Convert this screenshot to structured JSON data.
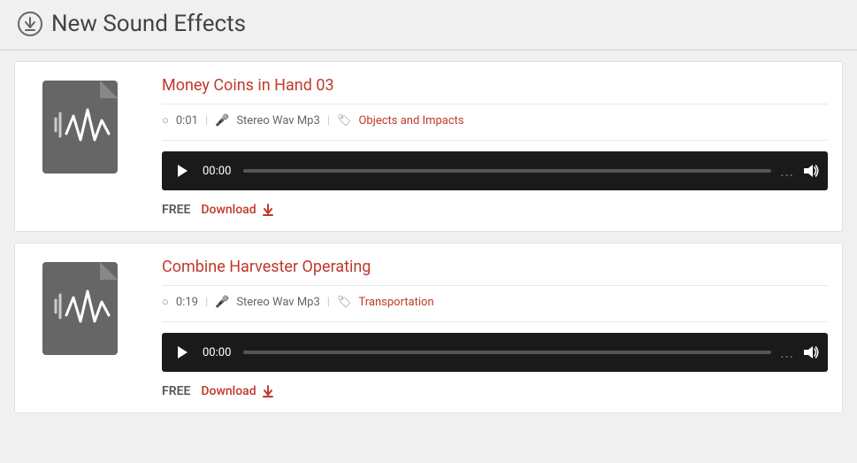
{
  "header": {
    "title": "New Sound Effects",
    "icon": "download-circle-icon"
  },
  "sounds": [
    {
      "id": "sound-1",
      "title": "Money Coins in Hand 03",
      "duration": "0:01",
      "format": "Stereo Wav Mp3",
      "category": "Objects and Impacts",
      "time_display": "00:00",
      "price": "FREE",
      "download_label": "Download"
    },
    {
      "id": "sound-2",
      "title": "Combine Harvester Operating",
      "duration": "0:19",
      "format": "Stereo Wav Mp3",
      "category": "Transportation",
      "time_display": "00:00",
      "price": "FREE",
      "download_label": "Download"
    }
  ],
  "player": {
    "dots": "...",
    "play_icon": "play-icon",
    "volume_icon": "volume-icon"
  }
}
